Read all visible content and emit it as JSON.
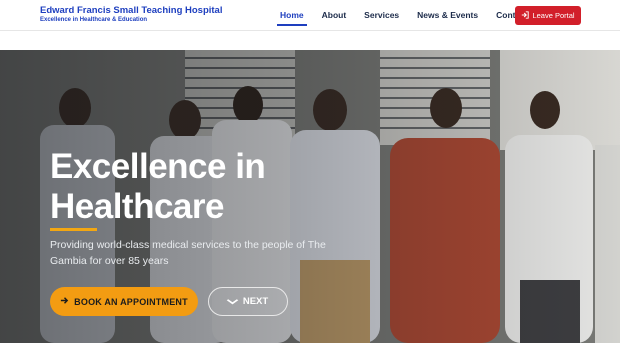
{
  "brand": {
    "name": "Edward Francis Small Teaching Hospital",
    "tagline": "Excellence in Healthcare & Education"
  },
  "nav": {
    "items": [
      {
        "label": "Home",
        "active": true
      },
      {
        "label": "About",
        "active": false
      },
      {
        "label": "Services",
        "active": false
      },
      {
        "label": "News & Events",
        "active": false
      },
      {
        "label": "Contact",
        "active": false
      }
    ],
    "leave_portal_label": "Leave Portal",
    "leave_portal_icon": "sign-out-icon"
  },
  "hero": {
    "title": "Excellence in Healthcare",
    "subtitle": "Providing world-class medical services to the people of The Gambia for over 85 years",
    "appointment_label": "BOOK AN APPOINTMENT",
    "appointment_icon": "arrow-right-icon",
    "next_label": "NEXT",
    "next_icon": "chevron-down-icon",
    "background_photo": "group-photo"
  },
  "colors": {
    "brand_blue": "#1e3fbf",
    "leave_red": "#d21f2a",
    "accent_orange": "#f39c12",
    "rule_yellow": "#f3a712"
  }
}
